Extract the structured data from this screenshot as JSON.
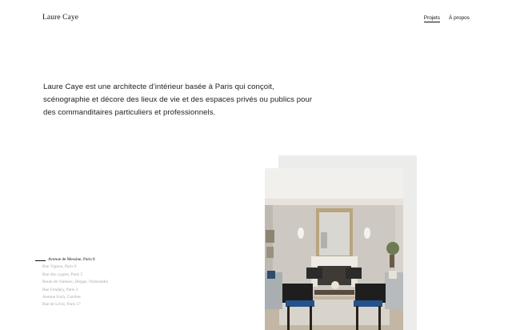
{
  "header": {
    "logo": "Laure Caye",
    "nav": [
      {
        "label": "Projets",
        "active": true
      },
      {
        "label": "À propos",
        "active": false
      }
    ]
  },
  "intro": {
    "lines": [
      "Laure Caye est une architecte d’intérieur basée à Paris qui conçoit,",
      "scénographie et décore des lieux de vie et des espaces privés ou publics pour",
      "des commanditaires particuliers et professionnels."
    ]
  },
  "projects": [
    {
      "label": "Avenue de Messine, Paris 8",
      "active": true
    },
    {
      "label": "Rue Vignon, Paris 9",
      "active": false
    },
    {
      "label": "Rue des cygnes, Paris 5",
      "active": false
    },
    {
      "label": "Route de Varenne, Dieppe, Normandie",
      "active": false
    },
    {
      "label": "Rue Fondary, Paris 3",
      "active": false
    },
    {
      "label": "Avenue Foch, Garches",
      "active": false
    },
    {
      "label": "Rue de Lévis, Paris 17",
      "active": false
    }
  ],
  "image": {
    "subject": "living-room-interior-photo"
  },
  "colors": {
    "text": "#1a1a1a",
    "muted": "#a8a8a8",
    "photo_bg": "#ececea"
  }
}
